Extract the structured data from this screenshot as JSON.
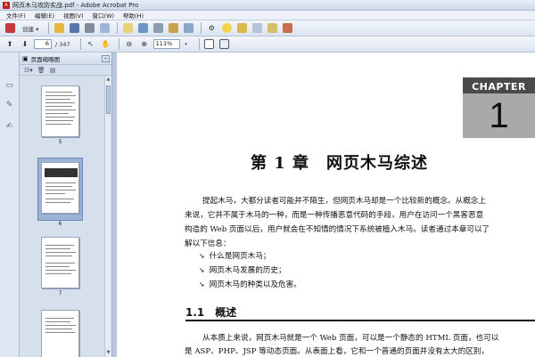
{
  "window": {
    "title": "网页木马攻防实战.pdf - Adobe Acrobat Pro"
  },
  "menu": [
    "文件(F)",
    "编辑(E)",
    "视图(V)",
    "窗口(W)",
    "帮助(H)"
  ],
  "toolbar": {
    "create_label": "创建 ▾"
  },
  "nav": {
    "current_page": "6",
    "total_pages": "/ 347",
    "zoom": "111%"
  },
  "panel": {
    "title": "页面缩略图",
    "thumbnails": [
      "5",
      "6",
      "7"
    ]
  },
  "document": {
    "chapter_word": "CHAPTER",
    "chapter_number": "1",
    "chapter_title": "第 1 章　网页木马综述",
    "paragraph_lines": [
      "提起木马，大都分读者可能并不陌生，但网页木马却是一个比较新的概念。从概念上",
      "来说，它并不属于木马的一种，而是一种传播恶意代码的手段，用户在访问一个黑客恶意",
      "构造的 Web 页面以后，用户就会在不知情的情况下系统被植入木马。读者通过本章可以了",
      "解以下信息："
    ],
    "bullets": [
      "什么是网页木马；",
      "网页木马发展的历史；",
      "网页木马的种类以及危害。"
    ],
    "section_title": "1.1　概述",
    "section_lines": [
      "从本质上来说，网页木马就是一个 Web 页面，可以是一个静态的 HTML 页面，也可以",
      "是 ASP、PHP、JSP 等动态页面。从表面上看，它和一个普通的页面并没有太大的区别，"
    ]
  },
  "colors": {
    "chrome": "#d6e0ed",
    "accent": "#4f6a91",
    "chapter_dark": "#4a4a4a",
    "chapter_gray": "#a9a9a9"
  }
}
